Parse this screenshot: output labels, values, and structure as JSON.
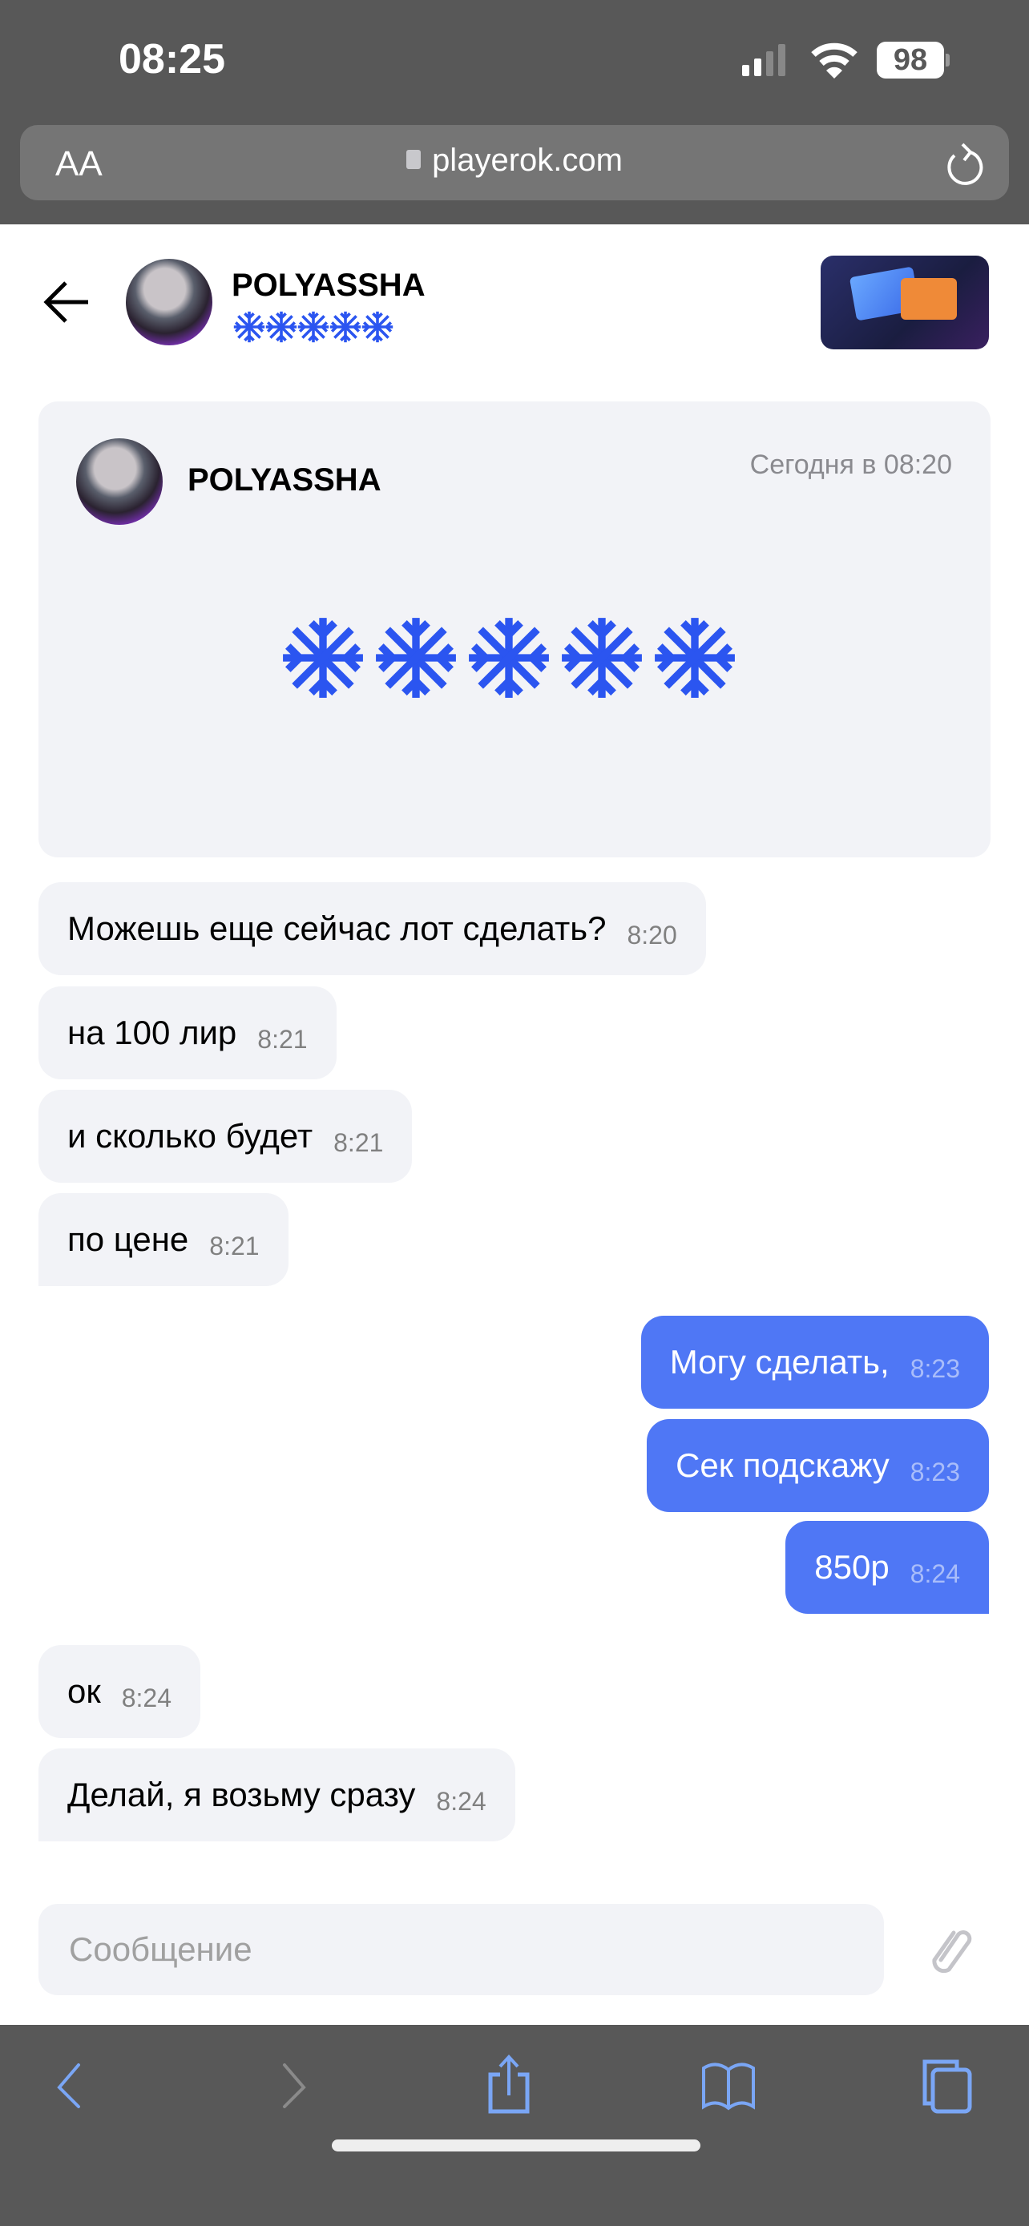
{
  "status_bar": {
    "time": "08:25",
    "battery": "98",
    "signal_bars": 2,
    "wifi": true
  },
  "browser": {
    "text_size_label": "AA",
    "url": "playerok.com"
  },
  "chat_header": {
    "name": "POLYASSHA",
    "rating_stars": 5,
    "star_color": "#2b55f0"
  },
  "review_card": {
    "name": "POLYASSHA",
    "date": "Сегодня в 08:20",
    "rating_stars": 5
  },
  "messages": [
    {
      "direction": "in",
      "text": "Можешь еще сейчас лот сделать?",
      "time": "8:20"
    },
    {
      "direction": "in",
      "text": "на 100 лир",
      "time": "8:21"
    },
    {
      "direction": "in",
      "text": "и сколько будет",
      "time": "8:21"
    },
    {
      "direction": "in",
      "text": "по цене",
      "time": "8:21"
    },
    {
      "direction": "out",
      "text": "Могу сделать,",
      "time": "8:23"
    },
    {
      "direction": "out",
      "text": "Сек подскажу",
      "time": "8:23"
    },
    {
      "direction": "out",
      "text": "850р",
      "time": "8:24"
    },
    {
      "direction": "in",
      "text": "ок",
      "time": "8:24"
    },
    {
      "direction": "in",
      "text": "Делай, я возьму сразу",
      "time": "8:24"
    }
  ],
  "composer": {
    "placeholder": "Сообщение",
    "value": ""
  },
  "colors": {
    "outgoing_bubble": "#4f77f5",
    "incoming_bubble": "#f2f3f7",
    "accent": "#2b55f0"
  },
  "toolbar": {
    "icons": [
      "back-icon",
      "forward-icon",
      "share-icon",
      "bookmarks-icon",
      "tabs-icon"
    ]
  }
}
